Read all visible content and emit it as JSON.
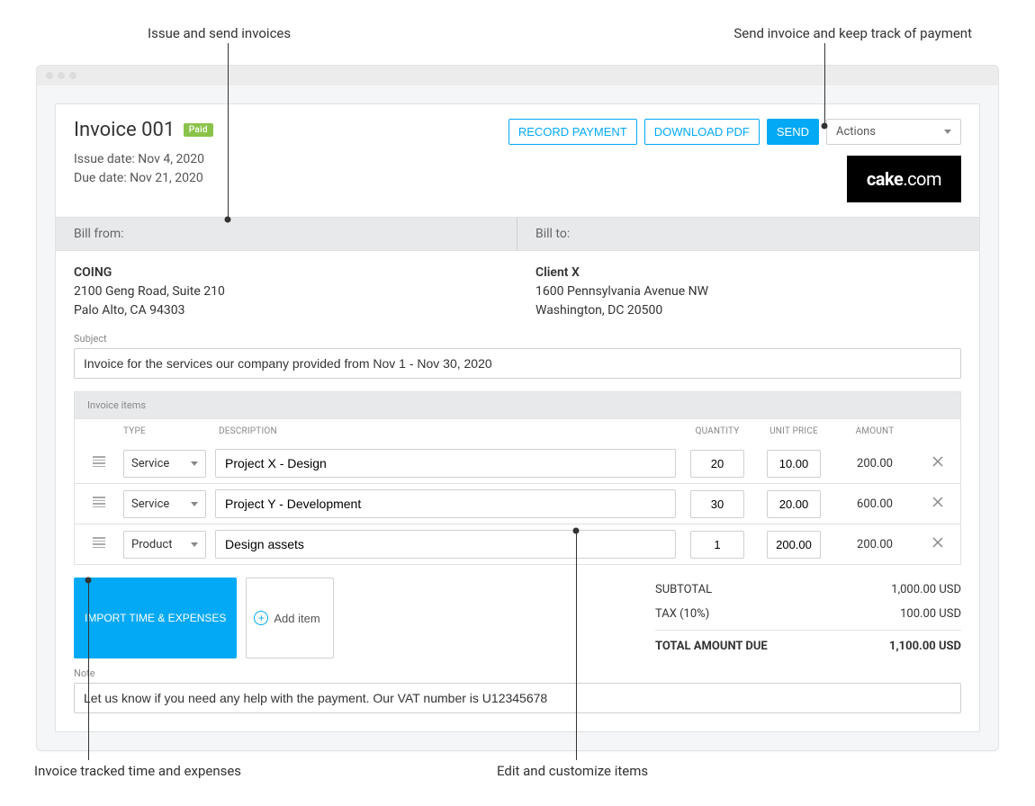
{
  "annotations": {
    "top_left": "Issue and send invoices",
    "top_right": "Send invoice and keep track of payment",
    "bottom_left": "Invoice tracked time and expenses",
    "bottom_right": "Edit and customize items"
  },
  "invoice": {
    "title": "Invoice 001",
    "status_badge": "Paid",
    "issue_date_label": "Issue date: Nov 4, 2020",
    "due_date_label": "Due date: Nov 21, 2020"
  },
  "buttons": {
    "record_payment": "RECORD PAYMENT",
    "download_pdf": "DOWNLOAD PDF",
    "send": "SEND",
    "actions": "Actions",
    "import": "IMPORT TIME & EXPENSES",
    "add_item": "Add item"
  },
  "logo": {
    "brand": "cake",
    "tld": ".com"
  },
  "bill_from": {
    "label": "Bill from:",
    "name": "COING",
    "line1": "2100 Geng Road, Suite 210",
    "line2": "Palo Alto, CA 94303"
  },
  "bill_to": {
    "label": "Bill to:",
    "name": "Client X",
    "line1": "1600 Pennsylvania Avenue NW",
    "line2": "Washington, DC 20500"
  },
  "subject": {
    "label": "Subject",
    "value": "Invoice for the services our company provided from Nov 1 - Nov 30, 2020"
  },
  "items_header": "Invoice items",
  "columns": {
    "type": "TYPE",
    "description": "DESCRIPTION",
    "quantity": "QUANTITY",
    "unit_price": "UNIT PRICE",
    "amount": "AMOUNT"
  },
  "items": [
    {
      "type": "Service",
      "description": "Project X - Design",
      "quantity": "20",
      "unit_price": "10.00",
      "amount": "200.00"
    },
    {
      "type": "Service",
      "description": "Project Y - Development",
      "quantity": "30",
      "unit_price": "20.00",
      "amount": "600.00"
    },
    {
      "type": "Product",
      "description": "Design assets",
      "quantity": "1",
      "unit_price": "200.00",
      "amount": "200.00"
    }
  ],
  "totals": {
    "subtotal_label": "SUBTOTAL",
    "subtotal_value": "1,000.00 USD",
    "tax_label": "TAX  (10%)",
    "tax_value": "100.00 USD",
    "due_label": "TOTAL AMOUNT DUE",
    "due_value": "1,100.00 USD"
  },
  "note": {
    "label": "Note",
    "value": "Let us know if you need any help with the payment. Our VAT number is U12345678"
  }
}
